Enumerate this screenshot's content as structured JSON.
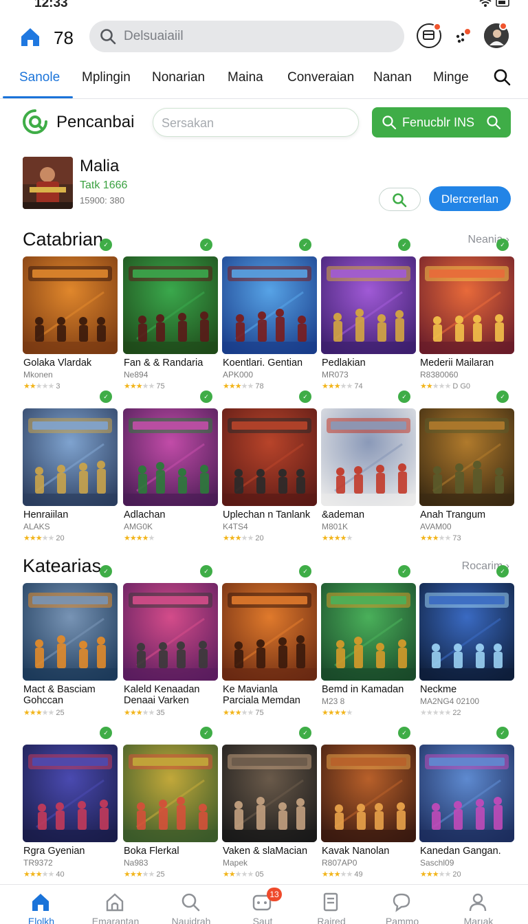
{
  "status_bar": {
    "time": "12:33"
  },
  "header": {
    "count": "78",
    "search_placeholder": "Delsuaiaiil",
    "profile_badge": "",
    "colors": {
      "accent": "#1a73d9",
      "green": "#3fad47",
      "badge": "#ef4a2b"
    }
  },
  "tabs": [
    "Sanole",
    "Mplingin",
    "Nonarian",
    "Maina",
    "Converaian",
    "Nanan",
    "Minge"
  ],
  "toolbar": {
    "brand": "Pencanbai",
    "search_placeholder": "Sersakan",
    "green_button": "Fenucblr INS"
  },
  "featured": {
    "title": "Malia",
    "subtitle": "Tatk 1666",
    "meta": "15900: 380",
    "action_button": "Dlercrerlan"
  },
  "sections": [
    {
      "title": "Catabrian",
      "link": "Neania",
      "rows": [
        [
          {
            "name": "Golaka Vlardak",
            "meta": "Mkonen",
            "rating_text": "3",
            "stars": 2
          },
          {
            "name": "Fan & & Randaria",
            "meta": "Ne894",
            "rating_text": "75",
            "stars": 3
          },
          {
            "name": "Koentlari. Gentian",
            "meta": "APK000",
            "rating_text": "78",
            "stars": 3
          },
          {
            "name": "Pedlakian",
            "meta": "MR073",
            "rating_text": "74",
            "stars": 3
          },
          {
            "name": "Mederii Mailaran",
            "meta": "R8380060",
            "rating_text": "D G0",
            "stars": 2
          }
        ],
        [
          {
            "name": "Henraiilan",
            "meta": "ALAKS",
            "rating_text": "20",
            "stars": 3
          },
          {
            "name": "Adlachan",
            "meta": "AMG0K",
            "rating_text": "",
            "stars": 4
          },
          {
            "name": "Uplechan n Tanlank",
            "meta": "K4TS4",
            "rating_text": "20",
            "stars": 3
          },
          {
            "name": "&ademan",
            "meta": "M801K",
            "rating_text": "",
            "stars": 4
          },
          {
            "name": "Anah Trangum",
            "meta": "AVAM00",
            "rating_text": "73",
            "stars": 3
          }
        ]
      ]
    },
    {
      "title": "Katearias",
      "link": "Rocarim",
      "rows": [
        [
          {
            "name": "Mact & Basciam",
            "name2": "Gohccan",
            "meta": "",
            "rating_text": "25",
            "stars": 3
          },
          {
            "name": "Kaleld Kenaadan",
            "name2": "Denaai Varken",
            "meta": "",
            "rating_text": "35",
            "stars": 3
          },
          {
            "name": "Ke Mavianla",
            "name2": "Parciala Memdan",
            "meta": "",
            "rating_text": "75",
            "stars": 3
          },
          {
            "name": "Bemd in Kamadan",
            "meta": "M23 8",
            "rating_text": "",
            "stars": 4
          },
          {
            "name": "Neckme",
            "meta": "MA2NG4 02100",
            "rating_text": "22",
            "stars": 0
          }
        ],
        [
          {
            "name": "Rgra Gyenian",
            "meta": "TR9372",
            "rating_text": "40",
            "stars": 3
          },
          {
            "name": "Boka Flerkal",
            "meta": "Na983",
            "rating_text": "25",
            "stars": 3
          },
          {
            "name": "Vaken & slaMacian",
            "meta": "Mapek",
            "rating_text": "05",
            "stars": 2
          },
          {
            "name": "Kavak Nanolan",
            "meta": "R807AP0",
            "rating_text": "49",
            "stars": 3
          },
          {
            "name": "Kanedan Gangan.",
            "meta": "Saschl09",
            "rating_text": "20",
            "stars": 3
          }
        ]
      ]
    }
  ],
  "bottom_nav": [
    {
      "label": "Elolkh",
      "icon": "home-icon",
      "active": true
    },
    {
      "label": "Emarantan",
      "icon": "house-outline-icon",
      "active": false
    },
    {
      "label": "Naujdrah",
      "icon": "search-icon",
      "active": false
    },
    {
      "label": "Saut",
      "icon": "gamepad-icon",
      "active": false,
      "badge": "13"
    },
    {
      "label": "Raired",
      "icon": "bookmark-icon",
      "active": false
    },
    {
      "label": "Pammo",
      "icon": "chat-icon",
      "active": false
    },
    {
      "label": "Marıak",
      "icon": "profile-icon",
      "active": false
    }
  ]
}
